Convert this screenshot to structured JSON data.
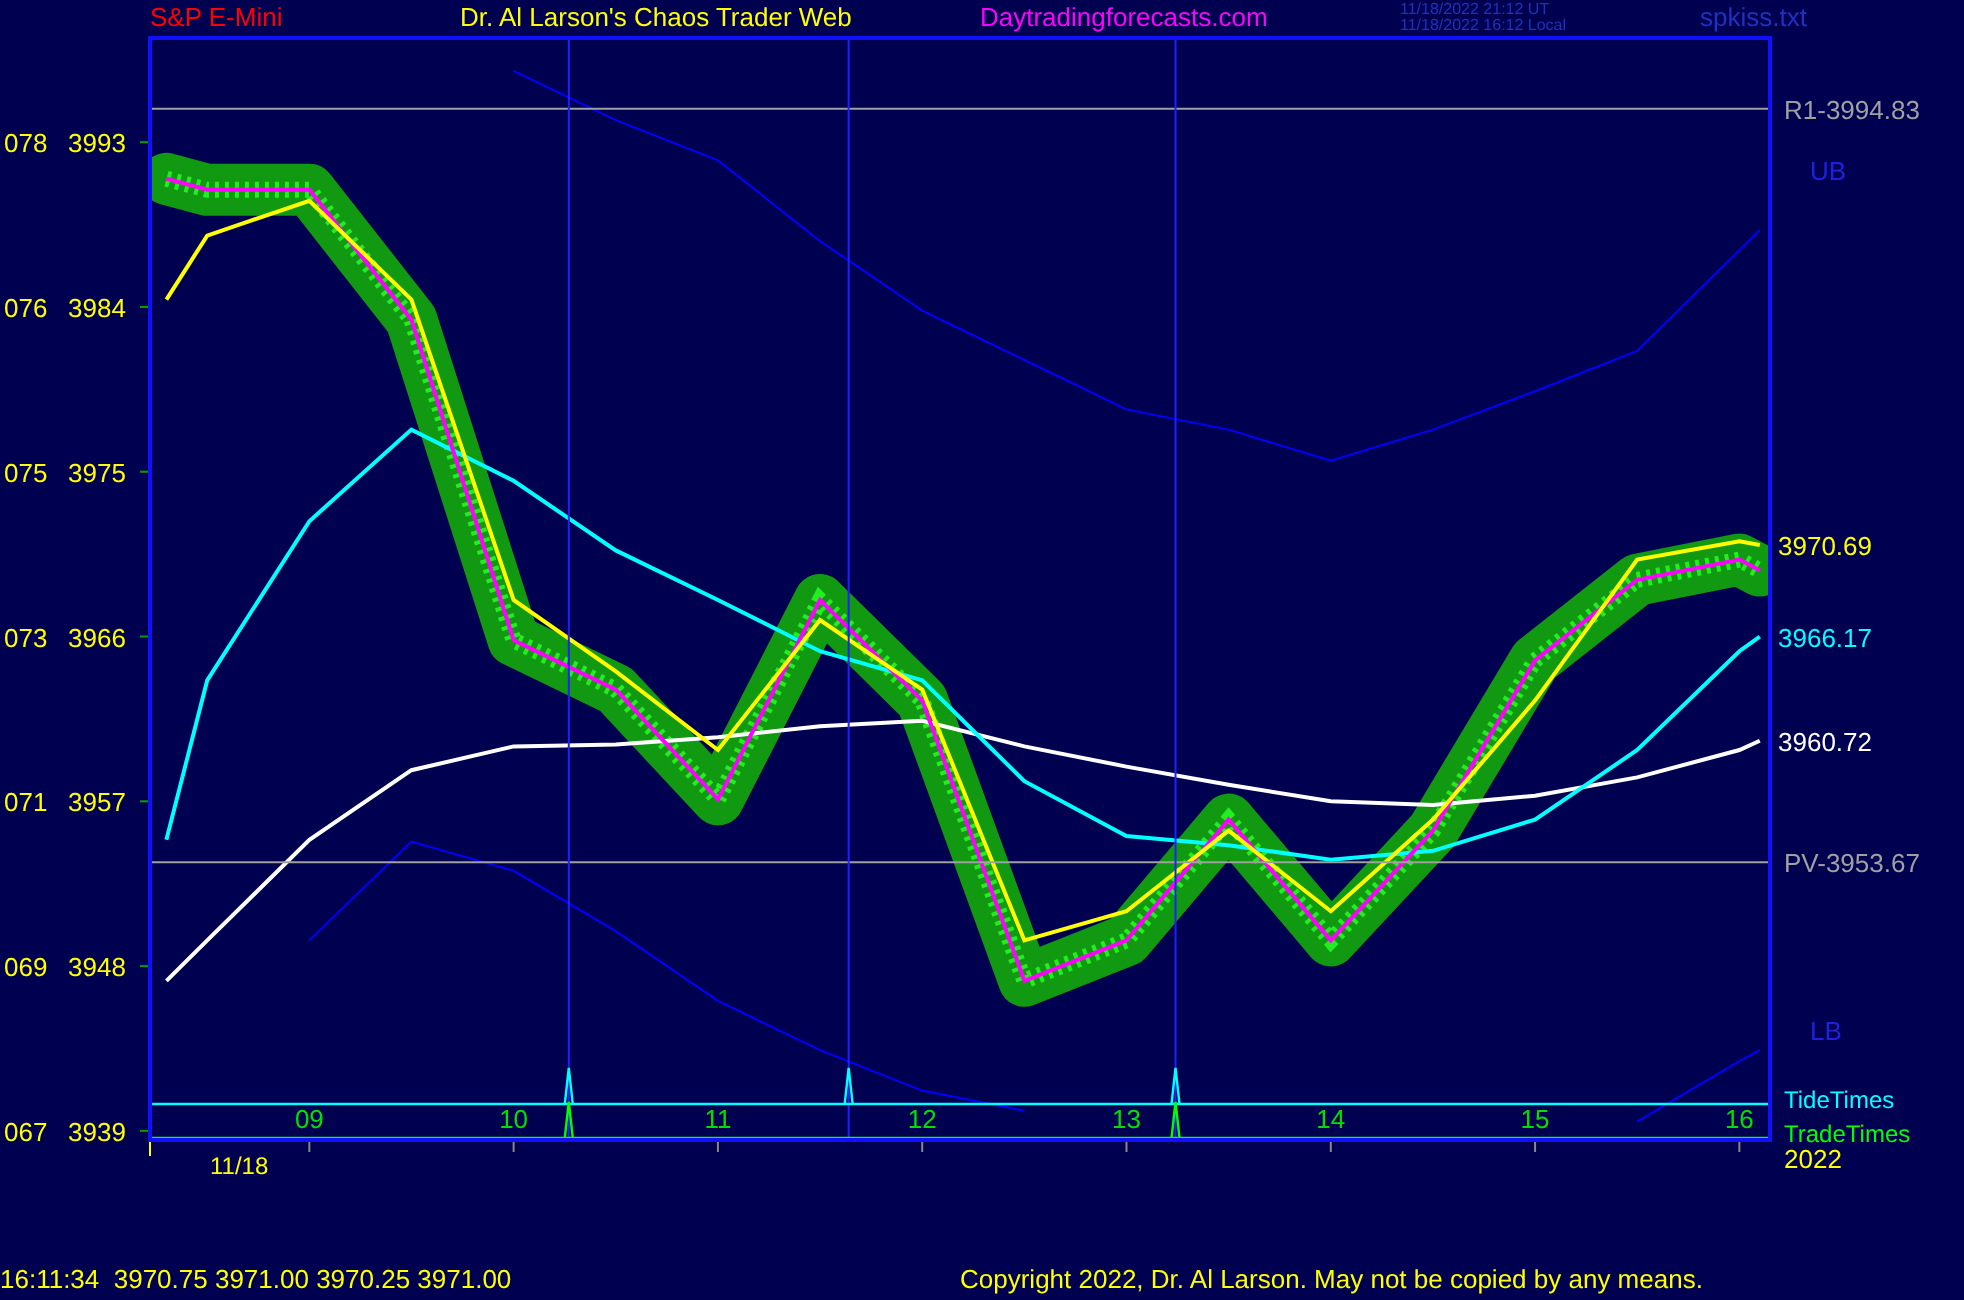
{
  "header": {
    "symbol": "S&P E-Mini",
    "title": "Dr. Al Larson's Chaos Trader Web",
    "website": "Daytradingforecasts.com",
    "time_ut": "11/18/2022 21:12 UT",
    "time_local": "11/18/2022 16:12 Local",
    "file": "spkiss.txt"
  },
  "chart": {
    "chart_data": {
      "type": "line",
      "x": [
        8.3,
        8.5,
        9,
        9.5,
        10,
        10.5,
        11,
        11.5,
        12,
        12.5,
        13,
        13.5,
        14,
        14.5,
        15,
        15.5,
        16,
        16.1
      ],
      "xlim": [
        8.22,
        16.15
      ],
      "ylim": [
        3938.5,
        3998.8
      ],
      "xticks": [
        {
          "value": 9,
          "label": "09"
        },
        {
          "value": 10,
          "label": "10"
        },
        {
          "value": 11,
          "label": "11"
        },
        {
          "value": 12,
          "label": "12"
        },
        {
          "value": 13,
          "label": "13"
        },
        {
          "value": 14,
          "label": "14"
        },
        {
          "value": 15,
          "label": "15"
        },
        {
          "value": 16,
          "label": "16"
        }
      ],
      "yticks": [
        3993,
        3984,
        3975,
        3966,
        3957,
        3948,
        3939
      ],
      "series": [
        {
          "name": "UB",
          "color": "#0000ff",
          "values": [
            null,
            null,
            null,
            null,
            3996.9,
            3994.2,
            3992,
            3987.6,
            3983.8,
            3981.1,
            3978.4,
            3977.3,
            3975.6,
            3977.3,
            3979.4,
            3981.6,
            3987.1,
            3988.2
          ]
        },
        {
          "name": "LB",
          "color": "#0000ff",
          "values": [
            null,
            null,
            3949.4,
            3954.8,
            3953.2,
            3949.9,
            3946.1,
            3943.4,
            3941.2,
            3940.1,
            null,
            null,
            null,
            null,
            null,
            3939.5,
            3942.8,
            3943.4
          ]
        },
        {
          "color": "#ffffff",
          "values": [
            3947.2,
            3949.4,
            3954.9,
            3958.7,
            3960,
            3960.1,
            3960.5,
            3961.1,
            3961.4,
            3960,
            3958.9,
            3957.9,
            3957,
            3956.8,
            3957.3,
            3958.3,
            3959.8,
            3960.3
          ]
        },
        {
          "color": "#00ffff",
          "values": [
            3954.9,
            3963.6,
            3972.3,
            3977.3,
            3974.5,
            3970.7,
            3968,
            3965.2,
            3963.6,
            3958.1,
            3955.1,
            3954.6,
            3953.8,
            3954.3,
            3956,
            3959.8,
            3965.2,
            3966
          ]
        },
        {
          "color": "#ff00ff",
          "values": [
            3991,
            3990.4,
            3990.4,
            3983.3,
            3965.8,
            3963.1,
            3957.1,
            3968,
            3962.5,
            3947.2,
            3949.4,
            3956,
            3949.4,
            3955.4,
            3964.7,
            3969.1,
            3970.2,
            3969.6
          ]
        },
        {
          "color": "#ffff00",
          "values": [
            3984.4,
            3987.9,
            3989.8,
            3984.4,
            3968,
            3964.1,
            3959.8,
            3966.9,
            3963.1,
            3949.4,
            3951,
            3955.4,
            3951,
            3956,
            3962.5,
            3970.2,
            3971.2,
            3971
          ]
        }
      ],
      "ref_lines": [
        {
          "axis": "y",
          "value": 3994.83,
          "label": "R1-3994.83"
        },
        {
          "axis": "y",
          "value": 3953.67,
          "label": "PV-3953.67"
        },
        {
          "axis": "x",
          "value": 10.27
        },
        {
          "axis": "x",
          "value": 11.64
        },
        {
          "axis": "x",
          "value": 13.24
        }
      ]
    },
    "index_labels": [
      "078",
      "076",
      "075",
      "073",
      "071",
      "069",
      "067"
    ],
    "end_values": [
      {
        "label": "3970.69",
        "color": "#ffff00"
      },
      {
        "label": "3966.17",
        "color": "#00ffff"
      },
      {
        "label": "3960.72",
        "color": "#ffffff"
      }
    ],
    "timings": [
      {
        "label": "TideTimes",
        "color": "#00ffff",
        "marks": [
          true,
          true,
          true
        ]
      },
      {
        "label": "TradeTimes",
        "color": "#00ff00",
        "marks": [
          true,
          false,
          true
        ]
      }
    ],
    "date": "11/18",
    "year": "2022"
  },
  "footer": {
    "quote": "16:11:34  3970.75 3971.00 3970.25 3971.00",
    "copyright": "Copyright 2022, Dr. Al Larson. May not be copied by any means."
  }
}
